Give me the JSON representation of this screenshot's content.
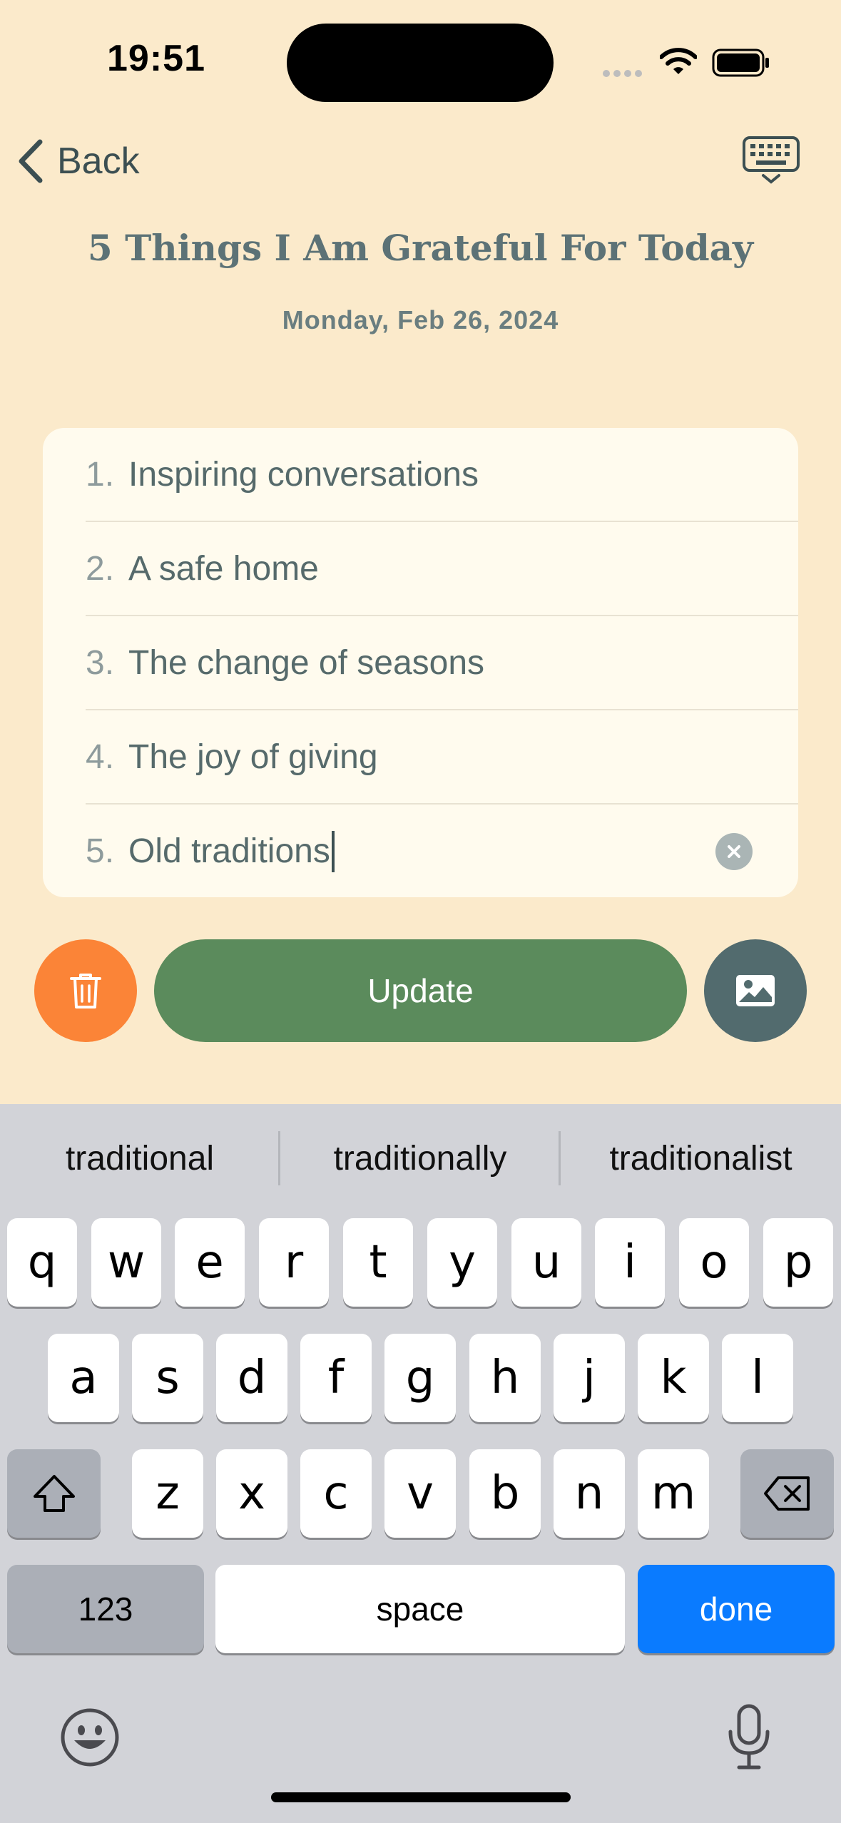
{
  "status_bar": {
    "time": "19:51"
  },
  "nav": {
    "back_label": "Back"
  },
  "entry": {
    "title": "5 Things I Am Grateful For Today",
    "date": "Monday, Feb 26, 2024",
    "items": [
      {
        "number": "1.",
        "text": "Inspiring conversations"
      },
      {
        "number": "2.",
        "text": "A safe home"
      },
      {
        "number": "3.",
        "text": "The change of seasons"
      },
      {
        "number": "4.",
        "text": "The joy of giving"
      },
      {
        "number": "5.",
        "text": "Old traditions"
      }
    ]
  },
  "actions": {
    "update_label": "Update"
  },
  "keyboard": {
    "suggestions": [
      "traditional",
      "traditionally",
      "traditionalist"
    ],
    "row1": [
      "q",
      "w",
      "e",
      "r",
      "t",
      "y",
      "u",
      "i",
      "o",
      "p"
    ],
    "row2": [
      "a",
      "s",
      "d",
      "f",
      "g",
      "h",
      "j",
      "k",
      "l"
    ],
    "row3": [
      "z",
      "x",
      "c",
      "v",
      "b",
      "n",
      "m"
    ],
    "numbers_label": "123",
    "space_label": "space",
    "done_label": "done"
  },
  "colors": {
    "background": "#fbeacb",
    "card": "#fffbee",
    "trash": "#fb8437",
    "update": "#5b8b5c",
    "image": "#526b6e",
    "done_key": "#0a7bff"
  }
}
